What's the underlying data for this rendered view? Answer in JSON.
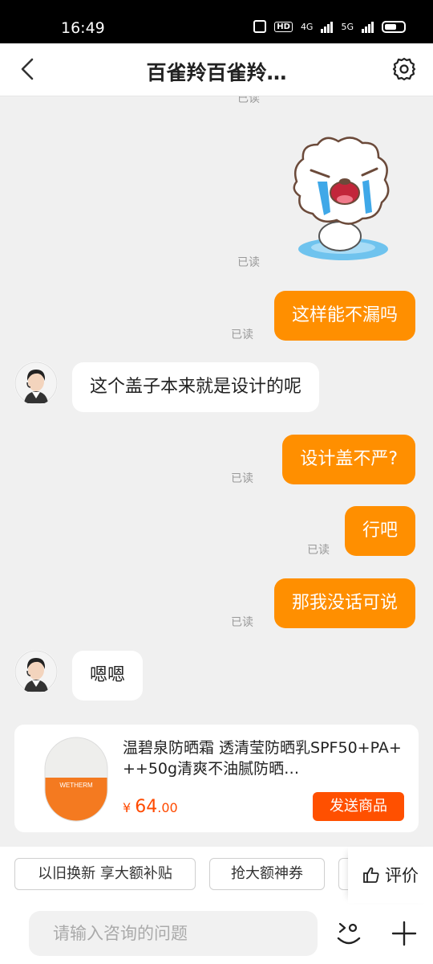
{
  "status_bar": {
    "time": "16:49",
    "hd_label": "HD",
    "net1": "4G",
    "net2": "5G"
  },
  "header": {
    "title": "百雀羚百雀羚…"
  },
  "chat": {
    "partial_read": "已读",
    "messages": [
      {
        "type": "sticker",
        "read": "已读"
      },
      {
        "text": "这样能不漏吗",
        "read": "已读"
      },
      {
        "text": "这个盖子本来就是设计的呢"
      },
      {
        "text": "设计盖不严?",
        "read": "已读"
      },
      {
        "text": "行吧",
        "read": "已读"
      },
      {
        "text": "那我没话可说",
        "read": "已读"
      },
      {
        "text": "嗯嗯"
      }
    ]
  },
  "product": {
    "title": "温碧泉防晒霜 透清莹防晒乳SPF50+PA+++50g清爽不油腻防晒…",
    "brand_label": "WETHERM",
    "currency": "¥",
    "price_int": "64",
    "price_dec": ".00",
    "send_label": "发送商品"
  },
  "quick_actions": {
    "chips": [
      "以旧换新 享大额补贴",
      "抢大额神券"
    ],
    "rate_label": "评价"
  },
  "input": {
    "placeholder": "请输入咨询的问题"
  },
  "colors": {
    "accent": "#ff8f00",
    "button": "#ff5000",
    "price": "#ff4a00"
  }
}
